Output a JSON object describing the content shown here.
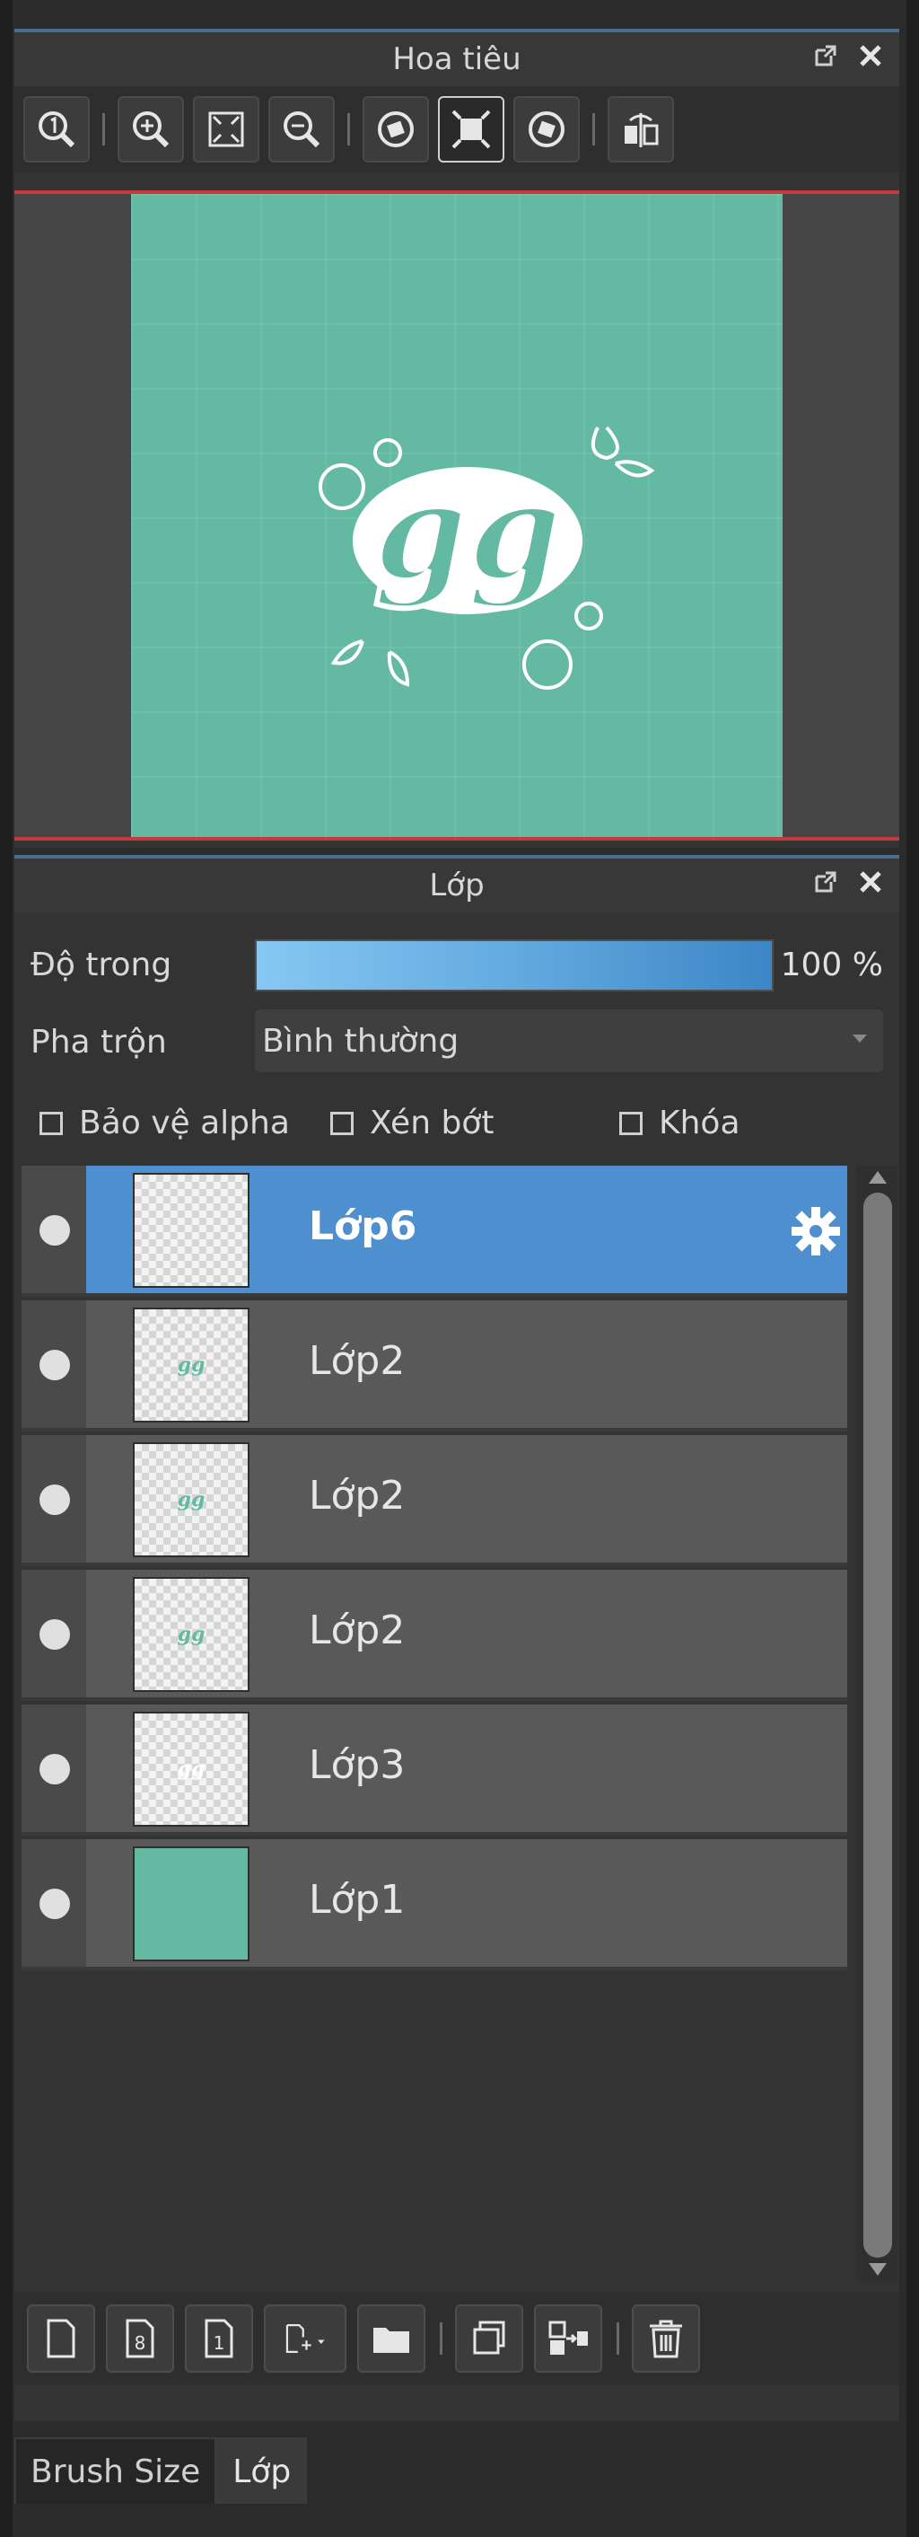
{
  "navigator": {
    "title": "Hoa tiêu",
    "toolbar_icons": [
      "zoom-actual-icon",
      "zoom-in-icon",
      "fit-screen-icon",
      "zoom-out-icon",
      "rotate-left-icon",
      "fullscreen-icon",
      "rotate-right-icon",
      "flip-horizontal-icon"
    ],
    "canvas_color": "#64b9a3",
    "artwork_text": "gg"
  },
  "layers_panel": {
    "title": "Lớp",
    "opacity_label": "Độ trong",
    "opacity_value": "100 %",
    "opacity_fraction": 1.0,
    "blend_label": "Pha trộn",
    "blend_mode": "Bình thường",
    "checkboxes": {
      "protect_alpha": "Bảo vệ alpha",
      "clipping": "Xén bớt",
      "lock": "Khóa"
    },
    "layers": [
      {
        "name": "Lớp6",
        "selected": true
      },
      {
        "name": "Lớp2"
      },
      {
        "name": "Lớp2"
      },
      {
        "name": "Lớp2"
      },
      {
        "name": "Lớp3"
      },
      {
        "name": "Lớp1"
      }
    ],
    "thumb_mini_text": "gg"
  },
  "bottom_tabs": [
    "Brush Size",
    "Lớp"
  ],
  "accent_color": "#4e8fcf"
}
